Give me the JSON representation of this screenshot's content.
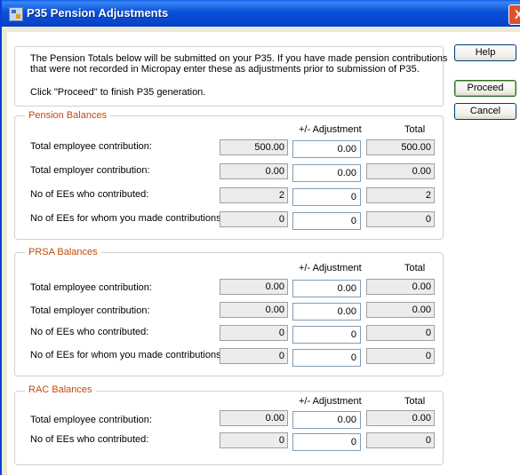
{
  "window": {
    "title": "P35 Pension Adjustments",
    "close_label": "X"
  },
  "info": {
    "line1": "The Pension Totals below will be submitted on your P35. If you have made pension contributions that were not recorded in Micropay enter these as adjustments prior to submission of P35.",
    "line2": "Click \"Proceed\" to finish P35 generation."
  },
  "buttons": {
    "help": "Help",
    "proceed": "Proceed",
    "cancel": "Cancel"
  },
  "columns": {
    "adjustment": "+/- Adjustment",
    "total": "Total"
  },
  "pension": {
    "title": "Pension Balances",
    "rows": [
      {
        "label": "Total employee contribution:",
        "value": "500.00",
        "adjustment": "0.00",
        "total": "500.00"
      },
      {
        "label": "Total employer contribution:",
        "value": "0.00",
        "adjustment": "0.00",
        "total": "0.00"
      },
      {
        "label": "No of EEs who contributed:",
        "value": "2",
        "adjustment": "0",
        "total": "2"
      },
      {
        "label": "No of EEs for whom you made contributions:",
        "value": "0",
        "adjustment": "0",
        "total": "0"
      }
    ]
  },
  "prsa": {
    "title": "PRSA Balances",
    "rows": [
      {
        "label": "Total employee contribution:",
        "value": "0.00",
        "adjustment": "0.00",
        "total": "0.00"
      },
      {
        "label": "Total employer contribution:",
        "value": "0.00",
        "adjustment": "0.00",
        "total": "0.00"
      },
      {
        "label": "No of EEs who contributed:",
        "value": "0",
        "adjustment": "0",
        "total": "0"
      },
      {
        "label": "No of EEs for whom you made contributions:",
        "value": "0",
        "adjustment": "0",
        "total": "0"
      }
    ]
  },
  "rac": {
    "title": "RAC Balances",
    "rows": [
      {
        "label": "Total employee contribution:",
        "value": "0.00",
        "adjustment": "0.00",
        "total": "0.00"
      },
      {
        "label": "No of EEs who contributed:",
        "value": "0",
        "adjustment": "0",
        "total": "0"
      }
    ]
  }
}
